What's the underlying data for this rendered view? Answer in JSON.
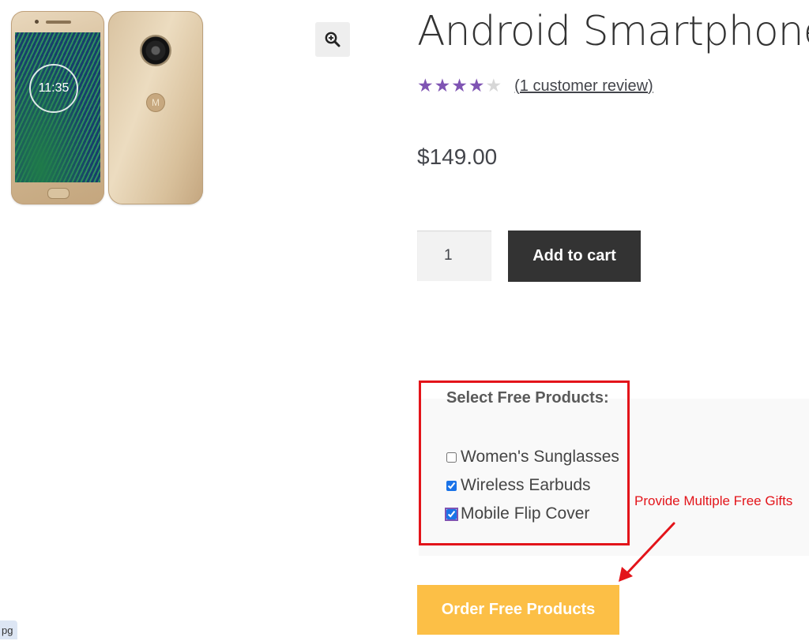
{
  "product": {
    "title": "Android Smartphone",
    "rating": 4,
    "rating_max": 5,
    "review_link": "(1 customer review)",
    "price": "$149.00",
    "quantity": "1",
    "add_to_cart_label": "Add to cart",
    "image": {
      "clock_text": "11:35",
      "brand_mark": "M"
    }
  },
  "free_products": {
    "heading": "Select Free Products:",
    "options": [
      {
        "label": "Women's Sunglasses",
        "checked": false
      },
      {
        "label": "Wireless Earbuds",
        "checked": true
      },
      {
        "label": "Mobile Flip Cover",
        "checked": true
      }
    ],
    "order_button_label": "Order Free Products"
  },
  "annotation": {
    "text": "Provide Multiple Free Gifts",
    "color": "#e3141a"
  },
  "corner_tag": "pg",
  "colors": {
    "star": "#7f54b3",
    "add_to_cart_bg": "#333333",
    "order_button_bg": "#fcbf46",
    "highlight_border": "#e3141a"
  },
  "icons": {
    "zoom": "zoom-in-icon",
    "star": "star-icon"
  }
}
